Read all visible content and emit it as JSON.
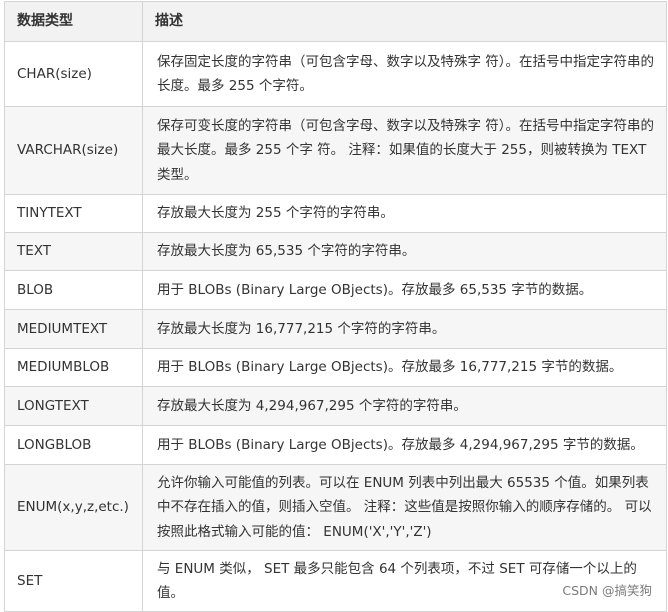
{
  "table": {
    "headers": [
      "数据类型",
      "描述"
    ],
    "rows": [
      {
        "type": "CHAR(size)",
        "desc": "保存固定长度的字符串（可包含字母、数字以及特殊字 符）。在括号中指定字符串的长度。最多 255 个字符。"
      },
      {
        "type": "VARCHAR(size)",
        "desc": "保存可变长度的字符串（可包含字母、数字以及特殊字 符）。在括号中指定字符串的最大长度。最多 255 个字 符。 注释：如果值的长度大于 255，则被转换为 TEXT 类型。"
      },
      {
        "type": "TINYTEXT",
        "desc": "存放最大长度为 255 个字符的字符串。"
      },
      {
        "type": "TEXT",
        "desc": "存放最大长度为 65,535 个字符的字符串。"
      },
      {
        "type": "BLOB",
        "desc": "用于 BLOBs (Binary Large OBjects)。存放最多 65,535 字节的数据。"
      },
      {
        "type": "MEDIUMTEXT",
        "desc": "存放最大长度为 16,777,215 个字符的字符串。"
      },
      {
        "type": "MEDIUMBLOB",
        "desc": "用于 BLOBs (Binary Large OBjects)。存放最多 16,777,215 字节的数据。"
      },
      {
        "type": "LONGTEXT",
        "desc": "存放最大长度为 4,294,967,295 个字符的字符串。"
      },
      {
        "type": "LONGBLOB",
        "desc": "用于 BLOBs (Binary Large OBjects)。存放最多 4,294,967,295 字节的数据。"
      },
      {
        "type": "ENUM(x,y,z,etc.)",
        "desc": "允许你输入可能值的列表。可以在 ENUM 列表中列出最大 65535 个值。如果列表中不存在插入的值，则插入空值。 注释：这些值是按照你输入的顺序存储的。 可以按照此格式输入可能的值： ENUM('X','Y','Z')"
      },
      {
        "type": "SET",
        "desc": "与 ENUM 类似， SET 最多只能包含 64 个列表项，不过 SET 可存储一个以上的值。"
      }
    ]
  },
  "watermark": "CSDN @搞笑狗",
  "colors": {
    "border": "#d4d4d4",
    "header_bg": "#f2f2f2",
    "stripe_bg": "#f6f6f6",
    "text": "#333333"
  }
}
